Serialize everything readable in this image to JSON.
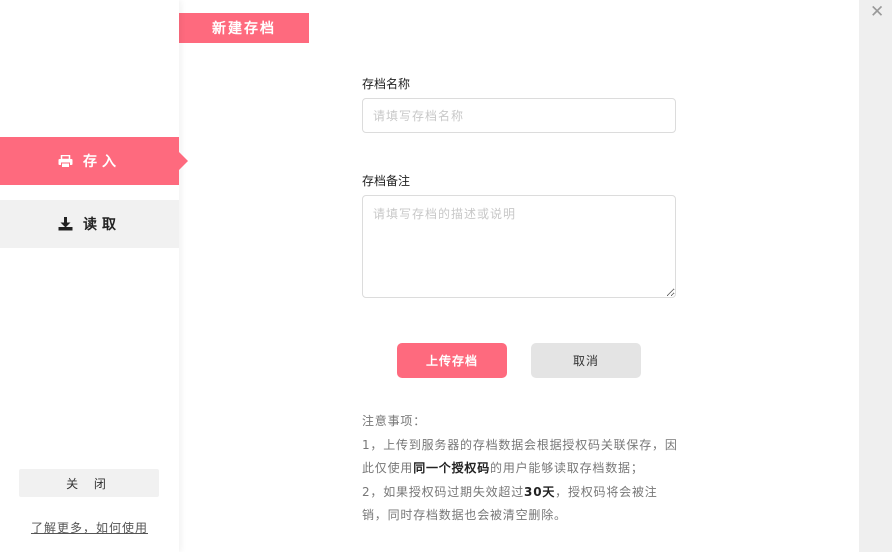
{
  "sidebar": {
    "save_tab": "存入",
    "load_tab": "读取",
    "close_label": "关 闭",
    "learn_more": "了解更多，如何使用"
  },
  "main": {
    "section_title": "新建存档",
    "name_label": "存档名称",
    "name_placeholder": "请填写存档名称",
    "note_label": "存档备注",
    "note_placeholder": "请填写存档的描述或说明",
    "upload_button": "上传存档",
    "cancel_button": "取消",
    "notes_title": "注意事项：",
    "note1_prefix": "1，上传到服务器的存档数据会根据授权码关联保存，因此仅使用",
    "note1_bold": "同一个授权码",
    "note1_suffix": "的用户能够读取存档数据；",
    "note2_prefix": "2，如果授权码过期失效超过",
    "note2_bold": "30天",
    "note2_suffix": "，授权码将会被注销，同时存档数据也会被清空删除。"
  },
  "window": {
    "close_symbol": "✕"
  },
  "colors": {
    "accent": "#fe6a7e",
    "panel": "#f1f1f1",
    "strip": "#efefef"
  },
  "icons": {
    "save": "printer-icon",
    "load": "download-icon",
    "close": "close-icon"
  }
}
